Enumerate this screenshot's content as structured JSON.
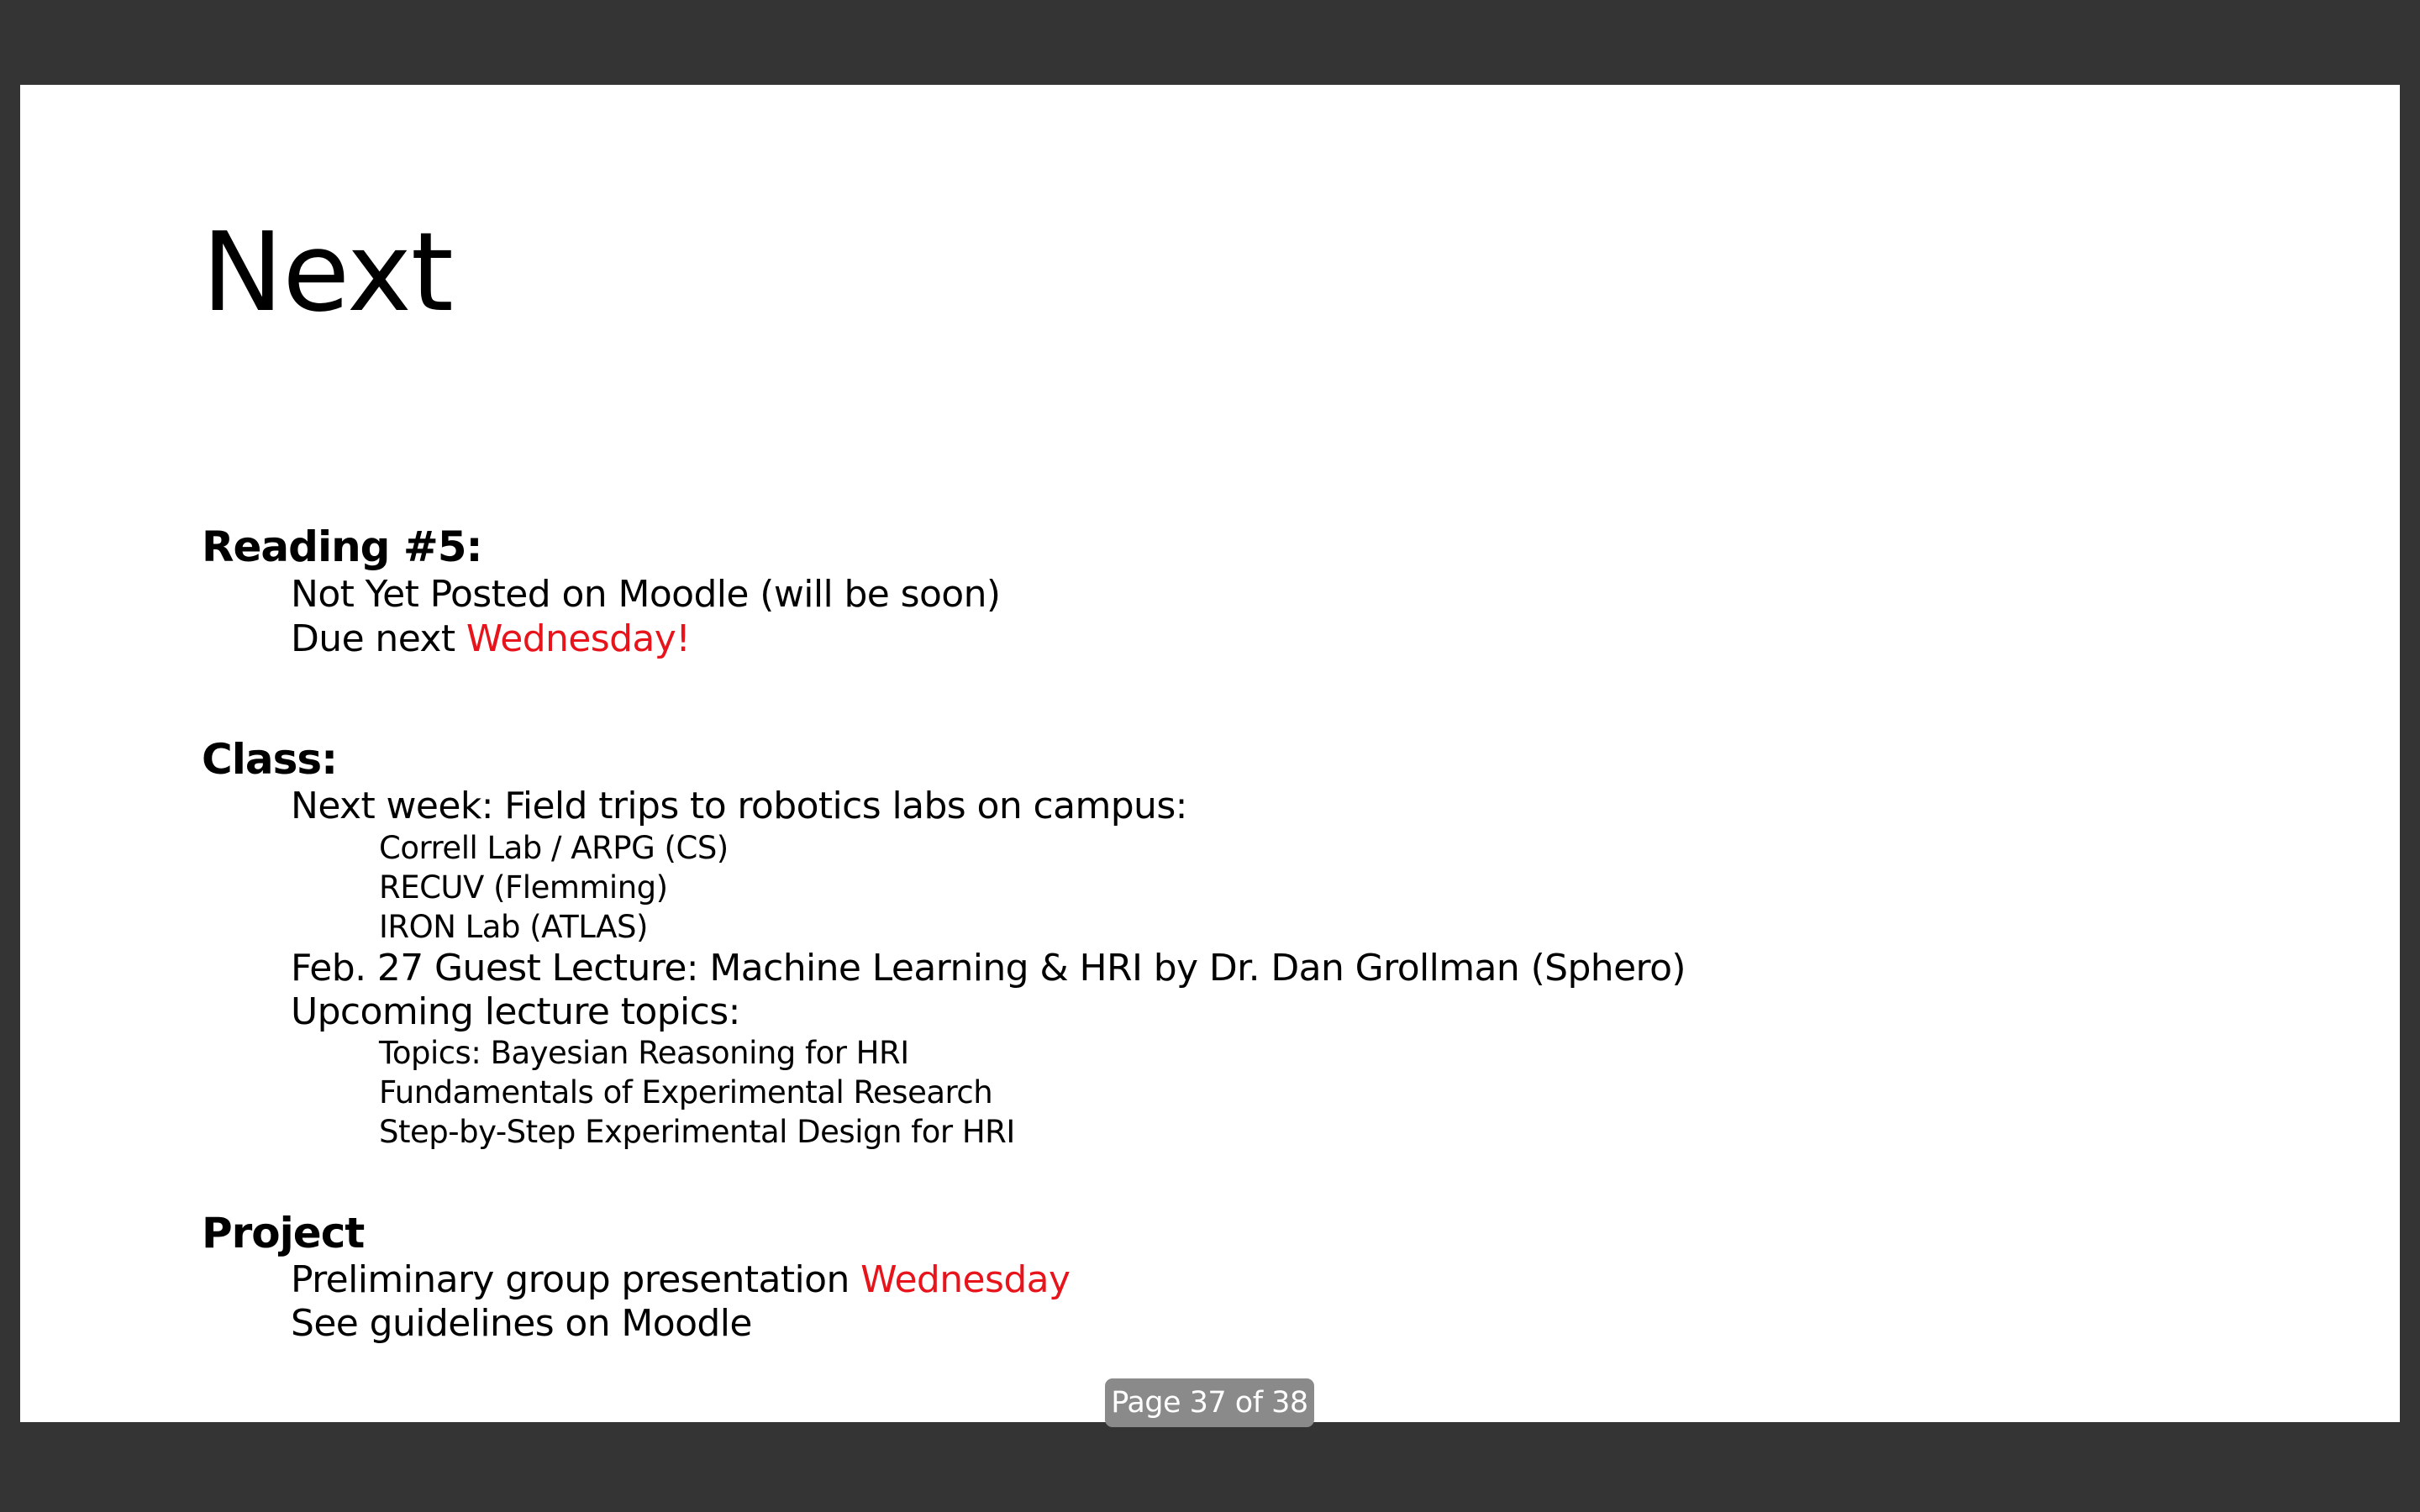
{
  "slide": {
    "title": "Next",
    "reading": {
      "heading": "Reading #5:",
      "line1": "Not Yet Posted on Moodle (will be soon)",
      "line2_prefix": "Due next ",
      "line2_highlight": "Wednesday!"
    },
    "class": {
      "heading": "Class:",
      "line1": "Next week: Field trips to robotics labs on campus:",
      "labs": [
        "Correll Lab / ARPG (CS)",
        "RECUV (Flemming)",
        "IRON Lab (ATLAS)"
      ],
      "line2": "Feb. 27 Guest Lecture: Machine Learning & HRI by Dr. Dan Grollman (Sphero)",
      "line3": "Upcoming lecture topics:",
      "topics": [
        "Topics: Bayesian Reasoning for HRI",
        "Fundamentals of Experimental Research",
        "Step-by-Step Experimental Design for HRI"
      ]
    },
    "project": {
      "heading": "Project",
      "line1_prefix": "Preliminary group presentation ",
      "line1_highlight": "Wednesday",
      "line2": "See guidelines on Moodle"
    }
  },
  "viewer": {
    "page_indicator": "Page 37 of 38",
    "background_color": "#343434",
    "highlight_color": "#e8141b"
  }
}
